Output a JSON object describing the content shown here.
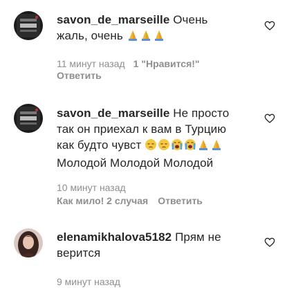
{
  "comments": [
    {
      "username": "savon_de_marseille",
      "text_line1": " Очень",
      "text_line2": "жаль, очень",
      "emojis_line2": [
        "praying-hands",
        "praying-hands",
        "praying-hands"
      ],
      "time": "11 минут назад",
      "likes": "1 \"Нравится!\"",
      "reply": "Ответить"
    },
    {
      "username": "savon_de_marseille",
      "text_line1": " Не просто",
      "text_line2": "так он приехал к вам в Турцию",
      "text_line3": "как будто чувст",
      "emojis_line3": [
        "pensive-face",
        "pensive-face",
        "loudly-crying-face",
        "loudly-crying-face",
        "praying-hands",
        "praying-hands"
      ],
      "text_line4": "Молодой Молодой Молодой",
      "time": "10 минут назад",
      "reaction": "Как мило! 2 случая",
      "reply": "Ответить"
    },
    {
      "username": "elenamikhalova5182",
      "text_line1": " Прям не",
      "text_line2": "верится",
      "time": "9 минут назад"
    }
  ],
  "colors": {
    "text": "#262626",
    "meta": "#8e8e8e",
    "heart": "#262626"
  }
}
